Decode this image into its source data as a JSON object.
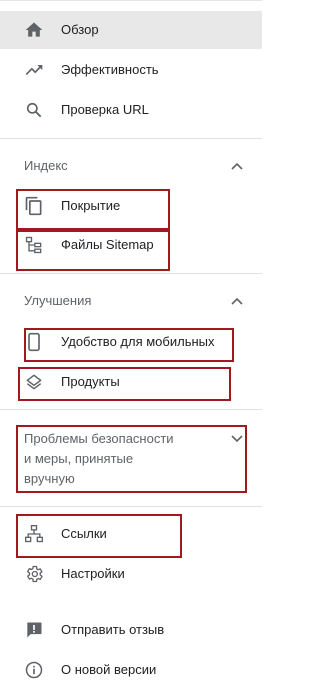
{
  "nav": {
    "top": [
      {
        "label": "Обзор",
        "icon": "home-icon",
        "active": true
      },
      {
        "label": "Эффективность",
        "icon": "trending-up-icon"
      },
      {
        "label": "Проверка URL",
        "icon": "search-icon"
      }
    ],
    "index": {
      "title": "Индекс",
      "items": [
        {
          "label": "Покрытие",
          "icon": "file-copy-icon"
        },
        {
          "label": "Файлы Sitemap",
          "icon": "sitemap-icon"
        }
      ]
    },
    "enhancements": {
      "title": "Улучшения",
      "items": [
        {
          "label": "Удобство для мобильных",
          "icon": "smartphone-icon"
        },
        {
          "label": "Продукты",
          "icon": "layers-icon"
        }
      ]
    },
    "security": {
      "title_lines": [
        "Проблемы безопасности",
        "и меры, принятые",
        "вручную"
      ]
    },
    "bottom": [
      {
        "label": "Ссылки",
        "icon": "links-icon"
      },
      {
        "label": "Настройки",
        "icon": "gear-icon"
      }
    ],
    "footer": [
      {
        "label": "Отправить отзыв",
        "icon": "feedback-icon"
      },
      {
        "label": "О новой версии",
        "icon": "info-icon"
      }
    ]
  },
  "colors": {
    "active_background": "#e8e8e8",
    "icon": "#5f6368",
    "highlight_border": "#a1191e"
  }
}
